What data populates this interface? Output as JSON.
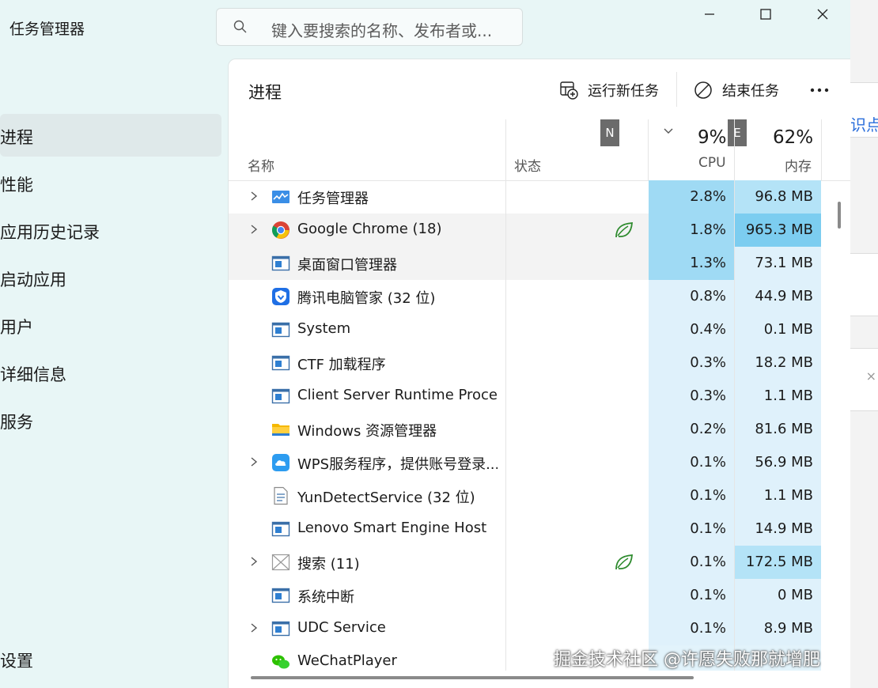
{
  "window": {
    "title": "任务管理器"
  },
  "search": {
    "placeholder": "键入要搜索的名称、发布者或..."
  },
  "window_controls": {
    "minimize": "minimize-icon",
    "maximize": "maximize-icon",
    "close": "close-icon"
  },
  "nav": {
    "items": [
      {
        "label": "进程",
        "active": true
      },
      {
        "label": "性能"
      },
      {
        "label": "应用历史记录"
      },
      {
        "label": "启动应用"
      },
      {
        "label": "用户"
      },
      {
        "label": "详细信息"
      },
      {
        "label": "服务"
      }
    ],
    "settings": "设置"
  },
  "page": {
    "title": "进程"
  },
  "toolbar": {
    "run_new_task": "运行新任务",
    "end_task": "结束任务",
    "more": "..."
  },
  "table": {
    "headers": {
      "name": "名称",
      "status": "状态",
      "cpu_pct": "9%",
      "cpu": "CPU",
      "mem_pct": "62%",
      "mem": "内存",
      "badge_n": "N",
      "badge_e": "E"
    },
    "rows": [
      {
        "name": "任务管理器",
        "cpu": "2.8%",
        "mem": "96.8 MB",
        "expand": true,
        "icon": "taskmgr-icon",
        "eco": false
      },
      {
        "name": "Google Chrome (18)",
        "cpu": "1.8%",
        "mem": "965.3 MB",
        "expand": true,
        "icon": "chrome-icon",
        "eco": true
      },
      {
        "name": "桌面窗口管理器",
        "cpu": "1.3%",
        "mem": "73.1 MB",
        "expand": false,
        "icon": "app-window-icon",
        "eco": false
      },
      {
        "name": "腾讯电脑管家 (32 位)",
        "cpu": "0.8%",
        "mem": "44.9 MB",
        "expand": false,
        "icon": "tencent-shield-icon",
        "eco": false
      },
      {
        "name": "System",
        "cpu": "0.4%",
        "mem": "0.1 MB",
        "expand": false,
        "icon": "app-window-icon",
        "eco": false
      },
      {
        "name": "CTF 加载程序",
        "cpu": "0.3%",
        "mem": "18.2 MB",
        "expand": false,
        "icon": "app-window-icon",
        "eco": false
      },
      {
        "name": "Client Server Runtime Proce...",
        "cpu": "0.3%",
        "mem": "1.1 MB",
        "expand": false,
        "icon": "app-window-icon",
        "eco": false
      },
      {
        "name": "Windows 资源管理器",
        "cpu": "0.2%",
        "mem": "81.6 MB",
        "expand": false,
        "icon": "folder-icon",
        "eco": false
      },
      {
        "name": "WPS服务程序，提供账号登录...",
        "cpu": "0.1%",
        "mem": "56.9 MB",
        "expand": true,
        "icon": "cloud-icon",
        "eco": false
      },
      {
        "name": "YunDetectService (32 位)",
        "cpu": "0.1%",
        "mem": "1.1 MB",
        "expand": false,
        "icon": "document-icon",
        "eco": false
      },
      {
        "name": "Lenovo Smart Engine Host",
        "cpu": "0.1%",
        "mem": "14.9 MB",
        "expand": false,
        "icon": "app-window-icon",
        "eco": false
      },
      {
        "name": "搜索 (11)",
        "cpu": "0.1%",
        "mem": "172.5 MB",
        "expand": true,
        "icon": "search-app-icon",
        "eco": true
      },
      {
        "name": "系统中断",
        "cpu": "0.1%",
        "mem": "0 MB",
        "expand": false,
        "icon": "app-window-icon",
        "eco": false
      },
      {
        "name": "UDC Service",
        "cpu": "0.1%",
        "mem": "8.9 MB",
        "expand": true,
        "icon": "app-window-icon",
        "eco": false
      },
      {
        "name": "WeChatPlayer",
        "cpu": "",
        "mem": "",
        "expand": false,
        "icon": "wechat-icon",
        "eco": false
      }
    ]
  },
  "background_app": {
    "text_1": "识点"
  },
  "watermark": "掘金技术社区 @许愿失败那就增肥"
}
